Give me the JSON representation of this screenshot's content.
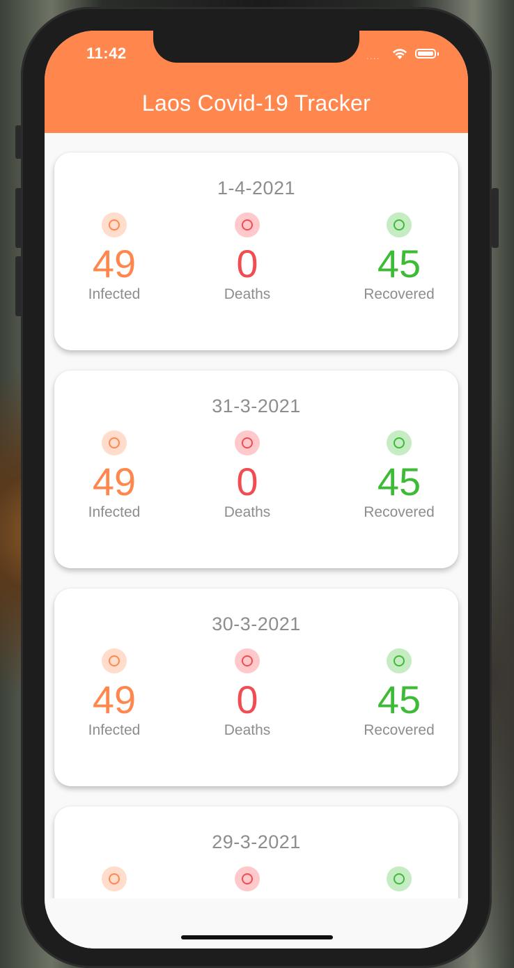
{
  "status_bar": {
    "time": "11:42",
    "signal": "....",
    "wifi_icon": "wifi-icon",
    "battery_icon": "battery-icon"
  },
  "app_bar": {
    "title": "Laos Covid-19 Tracker",
    "color": "#ff874e"
  },
  "colors": {
    "infected": "#ff874e",
    "deaths": "#f14c50",
    "recovered": "#3dbb36"
  },
  "labels": {
    "infected": "Infected",
    "deaths": "Deaths",
    "recovered": "Recovered"
  },
  "cards": [
    {
      "date": "1-4-2021",
      "infected": "49",
      "deaths": "0",
      "recovered": "45"
    },
    {
      "date": "31-3-2021",
      "infected": "49",
      "deaths": "0",
      "recovered": "45"
    },
    {
      "date": "30-3-2021",
      "infected": "49",
      "deaths": "0",
      "recovered": "45"
    },
    {
      "date": "29-3-2021",
      "infected": "",
      "deaths": "",
      "recovered": ""
    }
  ]
}
